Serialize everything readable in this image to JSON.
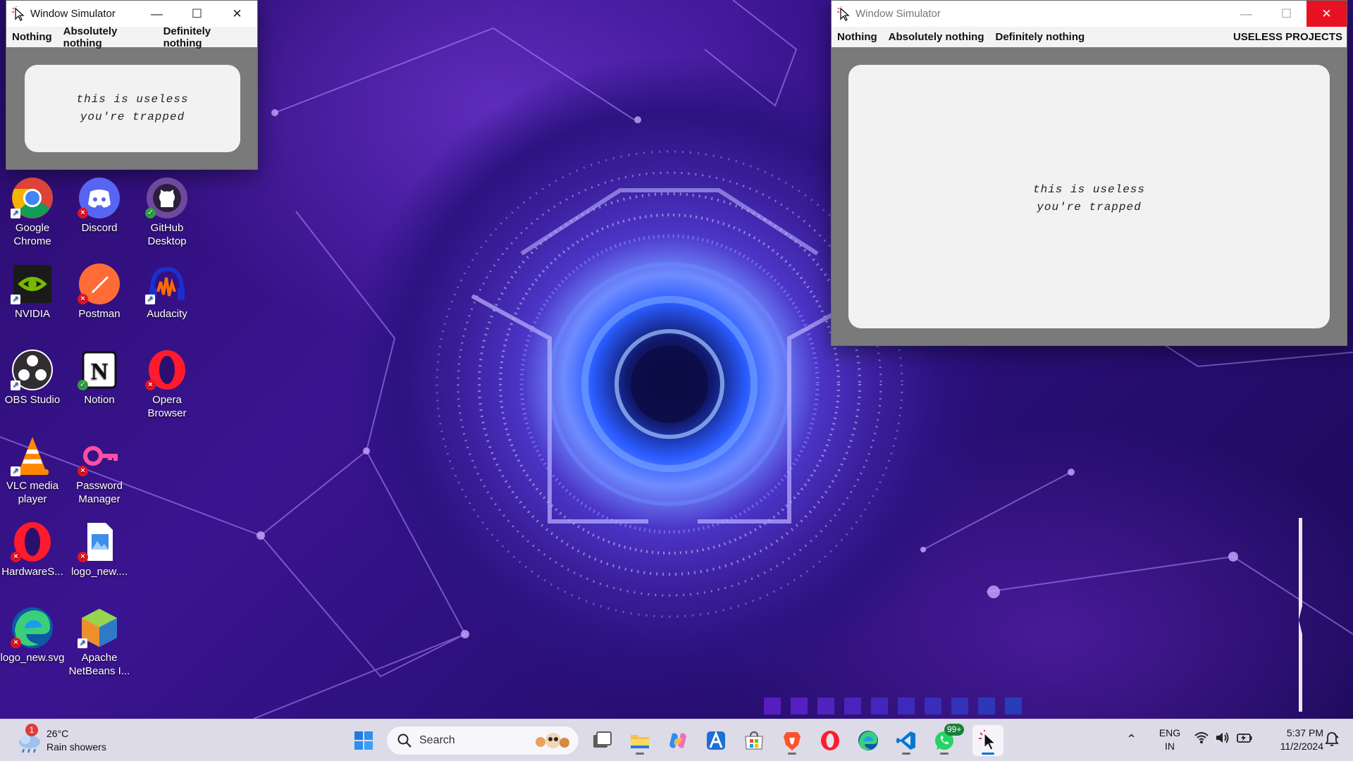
{
  "window_left": {
    "title": "Window Simulator",
    "menu": [
      "Nothing",
      "Absolutely nothing",
      "Definitely nothing"
    ],
    "panel_lines": [
      "this is useless",
      "you're trapped"
    ]
  },
  "window_right": {
    "title": "Window Simulator",
    "menu": [
      "Nothing",
      "Absolutely nothing",
      "Definitely nothing"
    ],
    "brand": "USELESS PROJECTS",
    "panel_lines": [
      "this is useless",
      "you're trapped"
    ]
  },
  "desktop_icons": [
    {
      "label": "Google Chrome",
      "icon": "chrome-icon",
      "badge": "shortcut"
    },
    {
      "label": "Discord",
      "icon": "discord-icon",
      "badge": "error"
    },
    {
      "label": "GitHub Desktop",
      "icon": "github-icon",
      "badge": "ok"
    },
    {
      "label": "NVIDIA",
      "icon": "nvidia-icon",
      "badge": "shortcut"
    },
    {
      "label": "Postman",
      "icon": "postman-icon",
      "badge": "error"
    },
    {
      "label": "Audacity",
      "icon": "audacity-icon",
      "badge": "shortcut"
    },
    {
      "label": "OBS Studio",
      "icon": "obs-icon",
      "badge": "shortcut"
    },
    {
      "label": "Notion",
      "icon": "notion-icon",
      "badge": "ok"
    },
    {
      "label": "Opera Browser",
      "icon": "opera-icon",
      "badge": "error"
    },
    {
      "label": "VLC media player",
      "icon": "vlc-icon",
      "badge": "shortcut"
    },
    {
      "label": "Password Manager",
      "icon": "key-icon",
      "badge": "error"
    },
    {
      "label": "HardwareS...",
      "icon": "opera-icon",
      "badge": "error"
    },
    {
      "label": "logo_new....",
      "icon": "image-file-icon",
      "badge": "error"
    },
    {
      "label": "logo_new.svg",
      "icon": "edge-icon",
      "badge": "error"
    },
    {
      "label": "Apache NetBeans I...",
      "icon": "netbeans-icon",
      "badge": "shortcut"
    }
  ],
  "taskbar": {
    "weather": {
      "temp": "26°C",
      "condition": "Rain showers",
      "notification_count": "1"
    },
    "search_placeholder": "Search",
    "apps": [
      "windows-start-icon",
      "search",
      "task-view-icon",
      "file-explorer-icon",
      "copilot-icon",
      "app-icon",
      "microsoft-store-icon",
      "brave-icon",
      "opera-icon",
      "edge-icon",
      "vscode-icon",
      "whatsapp-icon",
      "window-simulator-icon"
    ],
    "whatsapp_badge": "99+",
    "language": {
      "line1": "ENG",
      "line2": "IN"
    },
    "time": "5:37 PM",
    "date": "11/2/2024"
  },
  "colors": {
    "wallpaper_dark": "#2a0c6e",
    "wallpaper_ring": "#2a5cff",
    "window_frame": "#7a7a7a",
    "panel_bg": "#f2f2f2",
    "close_red": "#e81123",
    "taskbar_bg": "#e4e2ec",
    "accent": "#0a6fd8"
  }
}
